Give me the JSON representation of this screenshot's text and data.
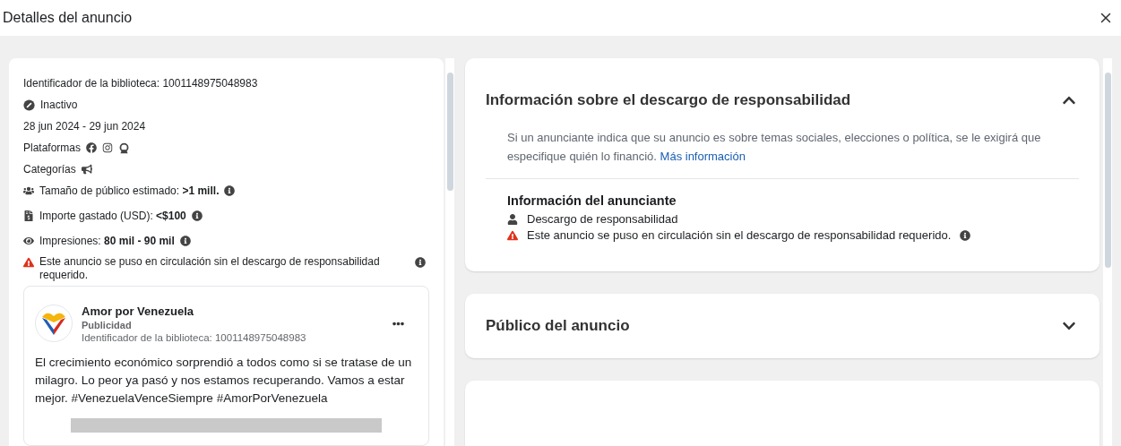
{
  "dialog": {
    "title": "Detalles del anuncio"
  },
  "details": [
    {
      "kind": "text",
      "label": "Identificador de la biblioteca: 1001148975048983"
    },
    {
      "kind": "status",
      "label": "Inactivo"
    },
    {
      "kind": "text",
      "label": "28 jun 2024 - 29 jun 2024"
    },
    {
      "kind": "platforms",
      "label": "Plataformas"
    },
    {
      "kind": "categories",
      "label": "Categorías"
    },
    {
      "kind": "audience",
      "label": "Tamaño de público estimado: **>1 mill.**"
    },
    {
      "kind": "spend",
      "label": "Importe gastado (USD): **<$100**"
    },
    {
      "kind": "impressions",
      "label": "Impresiones: **80 mil - 90 mil**"
    },
    {
      "kind": "warning",
      "label": "Este anuncio se puso en circulación sin el descargo de responsabilidad requerido."
    }
  ],
  "ad": {
    "page_name": "Amor por Venezuela",
    "sponsored": "Publicidad",
    "library_id": "Identificador de la biblioteca: 1001148975048983",
    "body": "El crecimiento económico sorprendió a todos como si se tratase de un milagro. Lo peor ya pasó y nos estamos recuperando. Vamos a estar mejor. #VenezuelaVenceSiempre #AmorPorVenezuela"
  },
  "sections": [
    {
      "title": "Información sobre el descargo de responsabilidad",
      "expanded": true,
      "description": "Si un anunciante indica que su anuncio es sobre temas sociales, elecciones o política, se le exigirá que especifique quién lo financió.",
      "link": "Más información",
      "advertiser_heading": "Información del anunciante",
      "advertiser_items": [
        {
          "kind": "person",
          "text": "Descargo de responsabilidad"
        },
        {
          "kind": "warning",
          "text": "Este anuncio se puso en circulación sin el descargo de responsabilidad requerido."
        }
      ]
    },
    {
      "title": "Público del anuncio",
      "expanded": false
    }
  ]
}
